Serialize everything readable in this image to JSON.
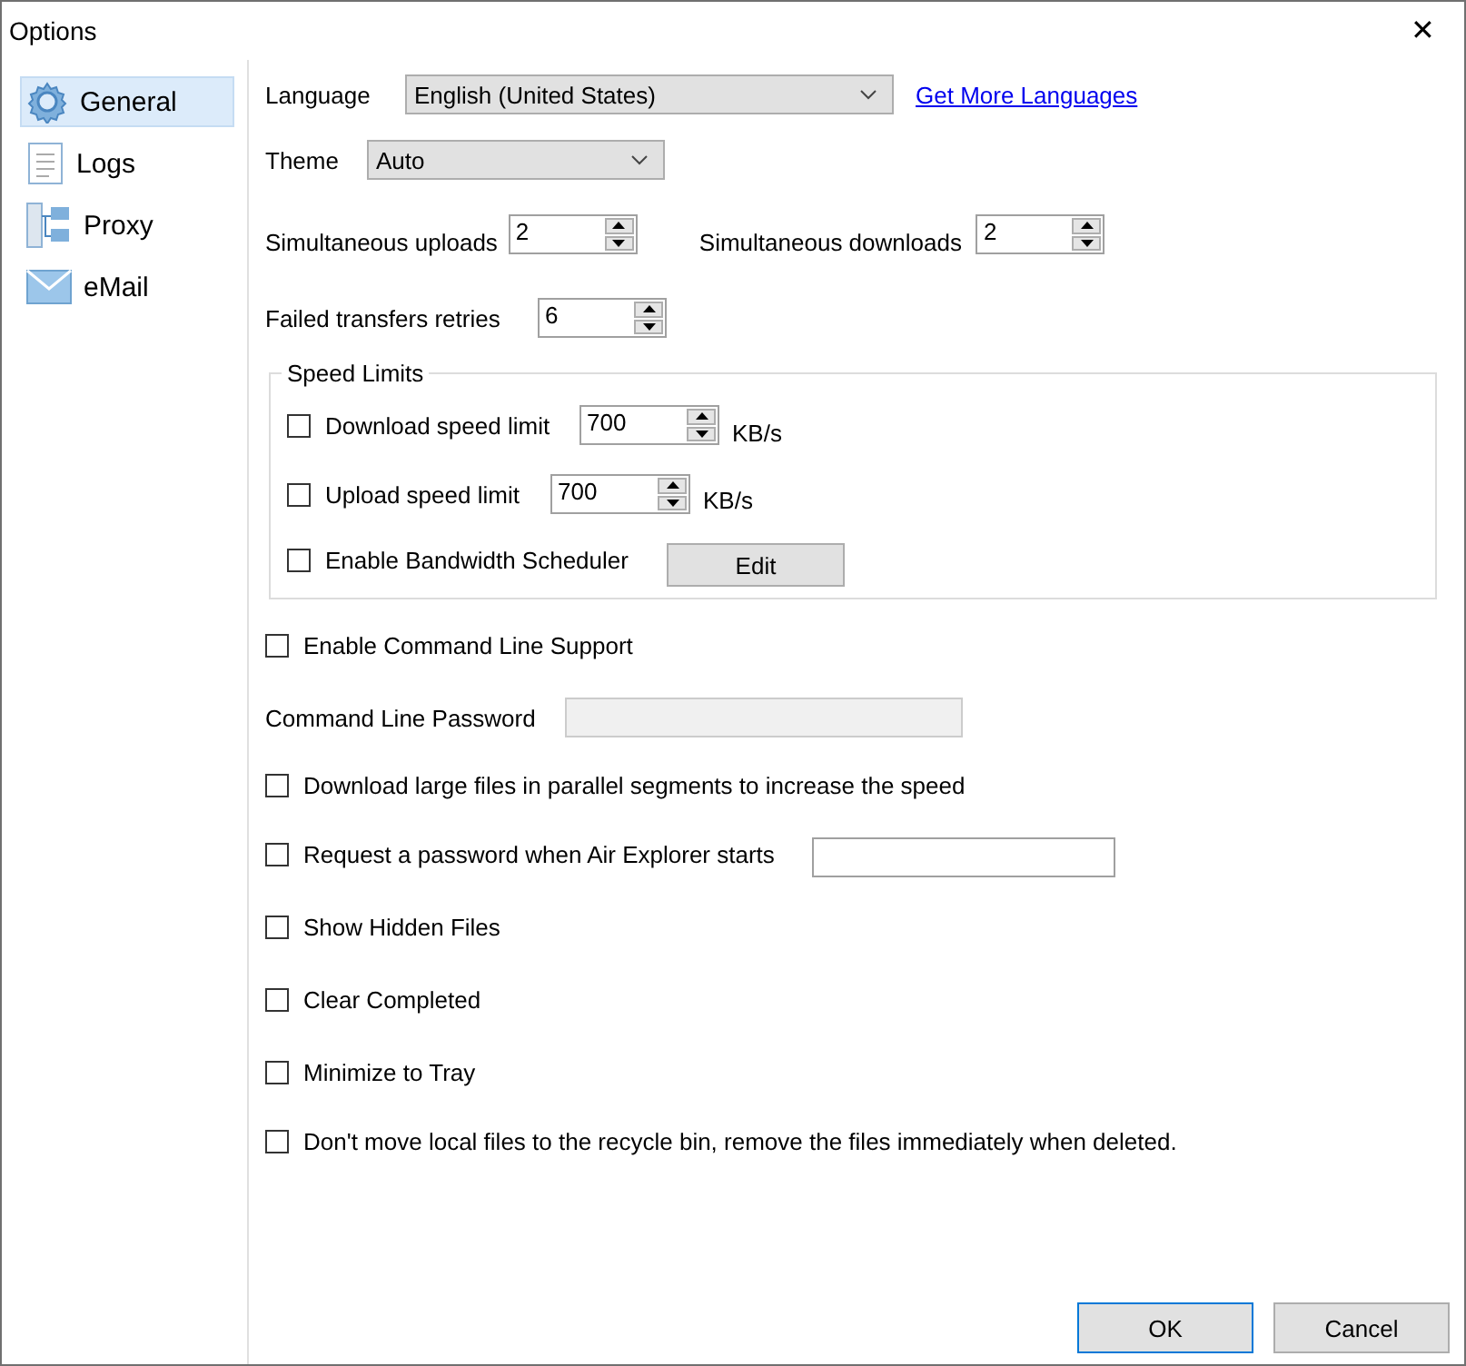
{
  "window": {
    "title": "Options",
    "close": "✕"
  },
  "sidebar": {
    "items": [
      {
        "label": "General",
        "selected": true
      },
      {
        "label": "Logs",
        "selected": false
      },
      {
        "label": "Proxy",
        "selected": false
      },
      {
        "label": "eMail",
        "selected": false
      }
    ]
  },
  "language": {
    "label": "Language",
    "value": "English (United States)",
    "link": "Get More Languages"
  },
  "theme": {
    "label": "Theme",
    "value": "Auto"
  },
  "uploads": {
    "label": "Simultaneous uploads",
    "value": "2"
  },
  "downloads": {
    "label": "Simultaneous downloads",
    "value": "2"
  },
  "retries": {
    "label": "Failed transfers retries",
    "value": "6"
  },
  "speed_limits": {
    "title": "Speed Limits",
    "download": {
      "label": "Download speed limit",
      "checked": false,
      "value": "700",
      "unit": "KB/s"
    },
    "upload": {
      "label": "Upload speed limit",
      "checked": false,
      "value": "700",
      "unit": "KB/s"
    },
    "scheduler": {
      "label": "Enable Bandwidth Scheduler",
      "checked": false,
      "button": "Edit"
    }
  },
  "command_line": {
    "label": "Enable Command Line Support",
    "checked": false
  },
  "command_password": {
    "label": "Command Line Password",
    "disabled": true
  },
  "options": [
    {
      "kind": "check",
      "label": "Download large files in parallel segments to increase the speed",
      "checked": false
    },
    {
      "kind": "field",
      "label": "Request a password when Air Explorer starts",
      "checked": false
    },
    {
      "kind": "check",
      "label": "Show Hidden Files",
      "checked": false
    },
    {
      "kind": "check",
      "label": "Clear Completed",
      "checked": false
    },
    {
      "kind": "check",
      "label": "Minimize to Tray",
      "checked": false
    },
    {
      "kind": "check",
      "label": "Don't move local files to the recycle bin, remove the files immediately when deleted.",
      "checked": false
    }
  ],
  "buttons": [
    {
      "label": "OK",
      "default": true
    },
    {
      "label": "Cancel",
      "default": false
    }
  ]
}
